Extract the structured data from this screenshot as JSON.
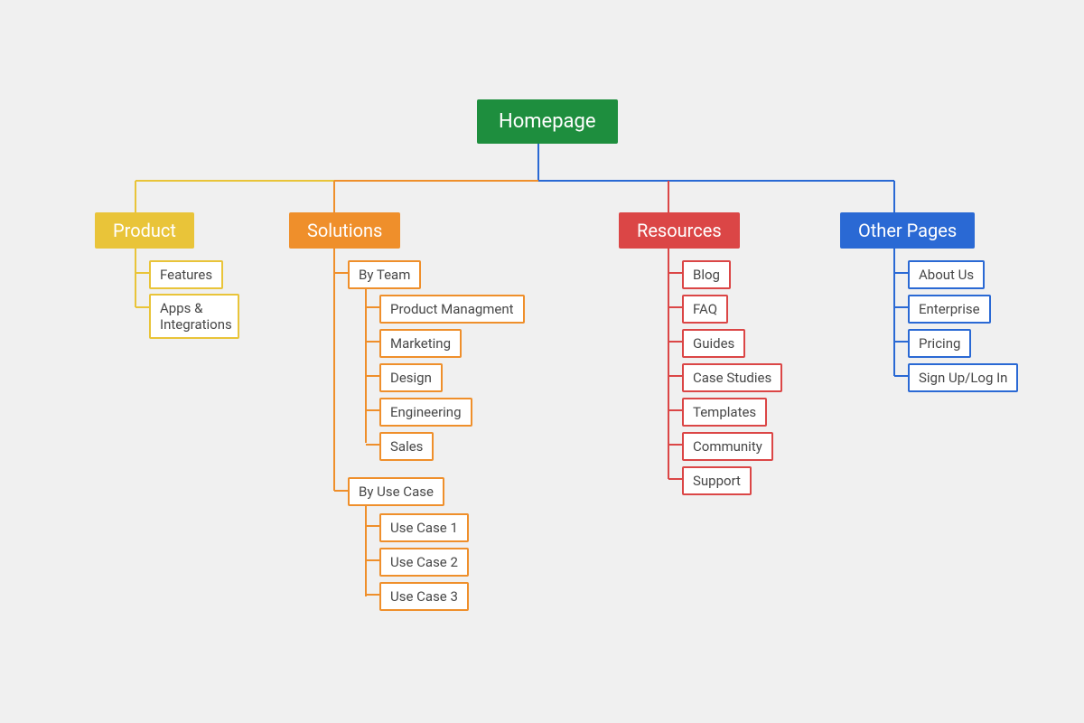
{
  "root": {
    "label": "Homepage"
  },
  "sections": {
    "product": {
      "title": "Product",
      "color": "#e9c439",
      "children": [
        "Features",
        "Apps & Integrations"
      ]
    },
    "solutions": {
      "title": "Solutions",
      "color": "#ef8f2b",
      "groups": [
        {
          "title": "By Team",
          "children": [
            "Product Managment",
            "Marketing",
            "Design",
            "Engineering",
            "Sales"
          ]
        },
        {
          "title": "By Use Case",
          "children": [
            "Use Case 1",
            "Use Case 2",
            "Use Case 3"
          ]
        }
      ]
    },
    "resources": {
      "title": "Resources",
      "color": "#db4646",
      "children": [
        "Blog",
        "FAQ",
        "Guides",
        "Case Studies",
        "Templates",
        "Community",
        "Support"
      ]
    },
    "other": {
      "title": "Other Pages",
      "color": "#2a69d4",
      "children": [
        "About Us",
        "Enterprise",
        "Pricing",
        "Sign Up/Log In"
      ]
    }
  },
  "colors": {
    "root": "#1e8e3e",
    "product": "#e9c439",
    "solutions": "#ef8f2b",
    "resources": "#db4646",
    "other": "#2a69d4"
  }
}
